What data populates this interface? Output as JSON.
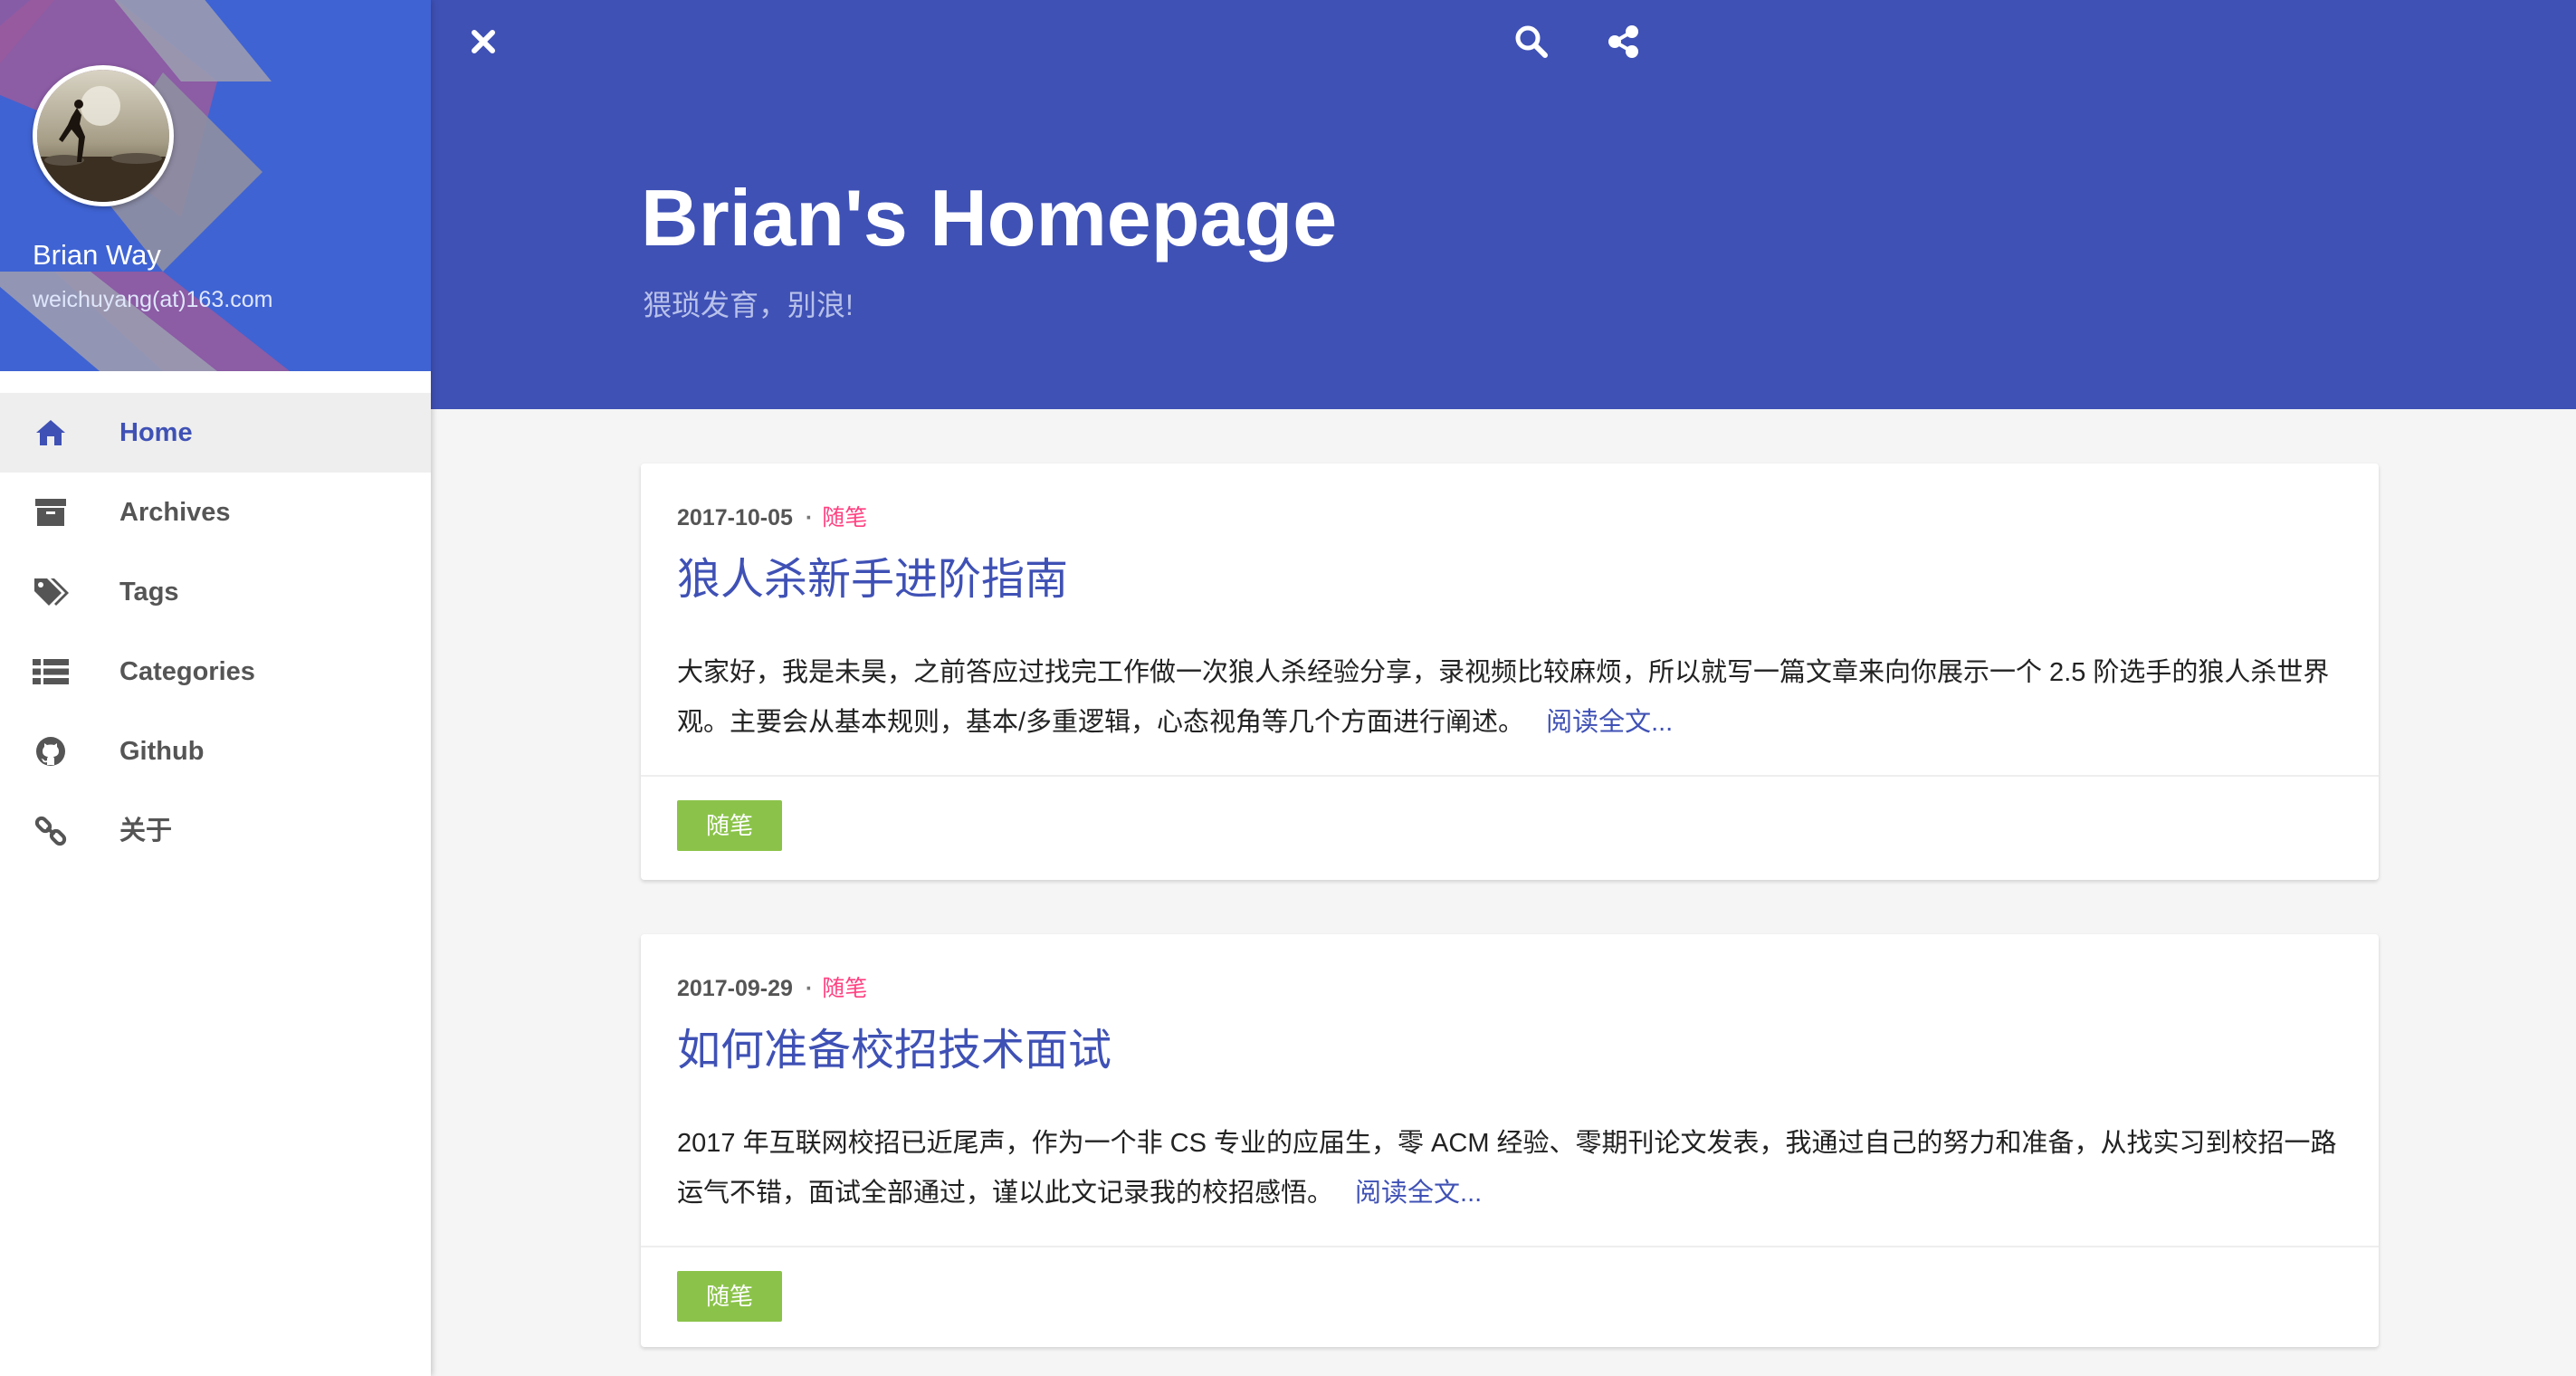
{
  "sidebar": {
    "profile": {
      "name": "Brian Way",
      "email": "weichuyang(at)163.com"
    },
    "items": [
      {
        "label": "Home",
        "icon": "home-icon",
        "active": true
      },
      {
        "label": "Archives",
        "icon": "archive-box-icon",
        "active": false
      },
      {
        "label": "Tags",
        "icon": "tags-icon",
        "active": false
      },
      {
        "label": "Categories",
        "icon": "list-icon",
        "active": false
      },
      {
        "label": "Github",
        "icon": "github-icon",
        "active": false
      },
      {
        "label": "关于",
        "icon": "link-icon",
        "active": false
      }
    ]
  },
  "header": {
    "title": "Brian's Homepage",
    "subtitle": "猥琐发育，别浪!",
    "icons": [
      "close-icon",
      "search-icon",
      "share-icon"
    ]
  },
  "posts": [
    {
      "date": "2017-10-05",
      "category": "随笔",
      "title": "狼人杀新手进阶指南",
      "excerpt": "大家好，我是未昊，之前答应过找完工作做一次狼人杀经验分享，录视频比较麻烦，所以就写一篇文章来向你展示一个 2.5 阶选手的狼人杀世界观。主要会从基本规则，基本/多重逻辑，心态视角等几个方面进行阐述。",
      "read_more": "阅读全文...",
      "tag": "随笔"
    },
    {
      "date": "2017-09-29",
      "category": "随笔",
      "title": "如何准备校招技术面试",
      "excerpt": "2017 年互联网校招已近尾声，作为一个非 CS 专业的应届生，零 ACM 经验、零期刊论文发表，我通过自己的努力和准备，从找实习到校招一路运气不错，面试全部通过，谨以此文记录我的校招感悟。",
      "read_more": "阅读全文...",
      "tag": "随笔"
    }
  ],
  "colors": {
    "primary": "#3f51b5",
    "accent": "#ff4081",
    "tag": "#8bc34a",
    "sidebar_header": "#3f63d3"
  }
}
